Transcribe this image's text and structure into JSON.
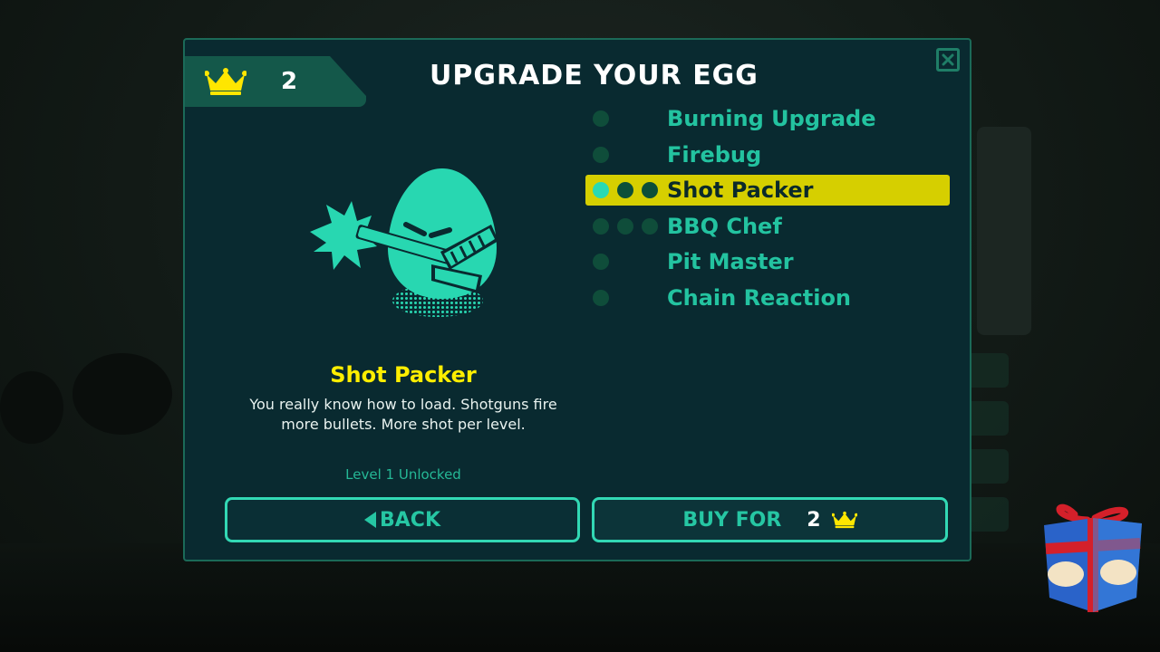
{
  "dialog": {
    "title": "UPGRADE YOUR EGG",
    "crowns": "2"
  },
  "upgrades": [
    {
      "label": "Burning Upgrade",
      "level": 0,
      "max_level": 1
    },
    {
      "label": "Firebug",
      "level": 0,
      "max_level": 1
    },
    {
      "label": "Shot Packer",
      "level": 1,
      "max_level": 3,
      "selected": true
    },
    {
      "label": "BBQ Chef",
      "level": 0,
      "max_level": 3
    },
    {
      "label": "Pit Master",
      "level": 0,
      "max_level": 1
    },
    {
      "label": "Chain Reaction",
      "level": 0,
      "max_level": 1
    }
  ],
  "selected": {
    "name": "Shot Packer",
    "description": "You really know how to load. Shotguns fire more bullets. More shot per level.",
    "status": "Level 1 Unlocked"
  },
  "buttons": {
    "back": "BACK",
    "buy": "BUY FOR",
    "buy_price": "2"
  },
  "colors": {
    "panel": "#092a30",
    "accent": "#28d7b1",
    "highlight": "#d6cf00",
    "crown": "#ffe600"
  },
  "icons": [
    "crown-icon",
    "close-icon",
    "back-arrow-icon",
    "gift-box-icon",
    "egg-shotgun-icon"
  ]
}
